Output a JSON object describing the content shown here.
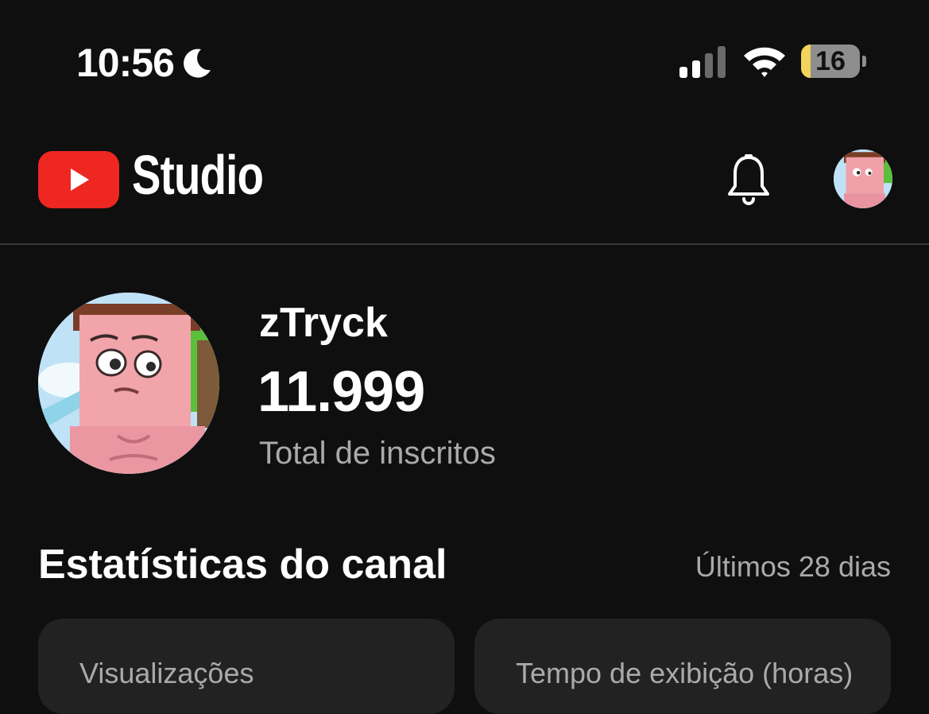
{
  "status_bar": {
    "time": "10:56",
    "battery_percent": "16",
    "battery_level": 0.16,
    "icons": [
      "moon-icon",
      "cellular-signal-icon",
      "wifi-icon",
      "battery-icon"
    ]
  },
  "header": {
    "logo_icon": "youtube-play-icon",
    "app_name": "Studio",
    "notifications_icon": "bell-icon",
    "account_icon": "avatar"
  },
  "channel": {
    "name": "zTryck",
    "subscriber_count": "11.999",
    "subscriber_label": "Total de inscritos"
  },
  "stats": {
    "title": "Estatísticas do canal",
    "period": "Últimos 28 dias",
    "cards": [
      {
        "label": "Visualizações"
      },
      {
        "label": "Tempo de exibição (horas)"
      }
    ]
  },
  "colors": {
    "background": "#0f0f0f",
    "card": "#222222",
    "youtube_red": "#ee2722",
    "secondary_text": "#aaaaaa",
    "battery_low": "#f2d35c"
  }
}
